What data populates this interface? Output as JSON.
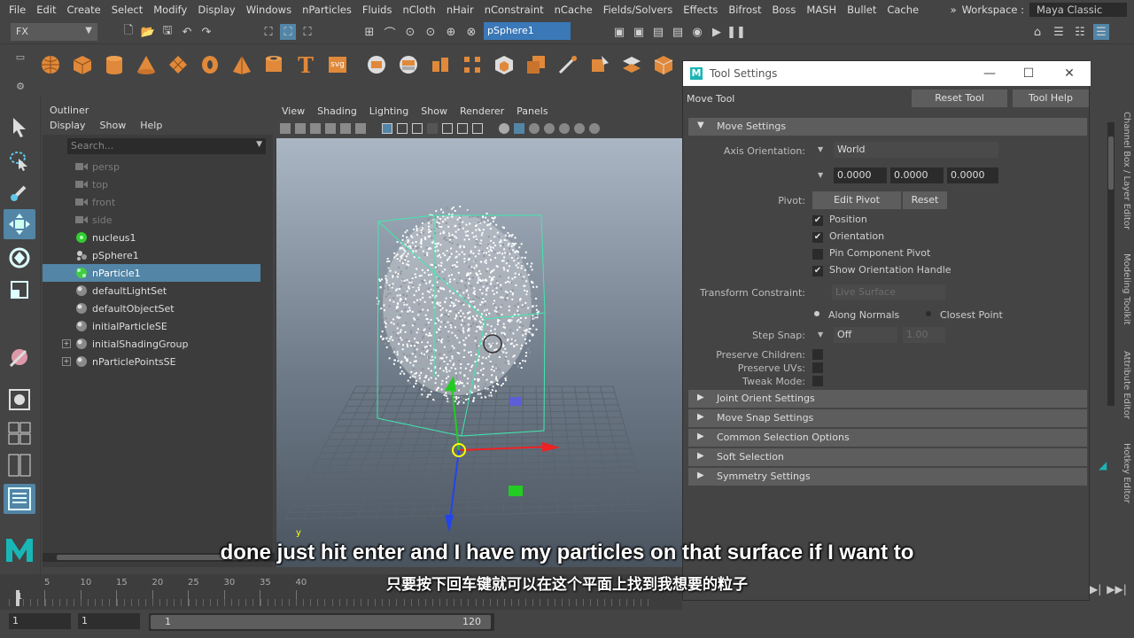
{
  "menubar": {
    "items": [
      "File",
      "Edit",
      "Create",
      "Select",
      "Modify",
      "Display",
      "Windows",
      "nParticles",
      "Fluids",
      "nCloth",
      "nHair",
      "nConstraint",
      "nCache",
      "Fields/Solvers",
      "Effects",
      "Bifrost",
      "Boss",
      "MASH",
      "Bullet",
      "Cache"
    ],
    "workspace_label": "Workspace :",
    "workspace_value": "Maya Classic"
  },
  "statusline": {
    "menuset": "FX",
    "object_name": "pSphere1"
  },
  "outliner": {
    "title": "Outliner",
    "menu": [
      "Display",
      "Show",
      "Help"
    ],
    "search_placeholder": "Search...",
    "items": [
      {
        "label": "persp",
        "icon": "camera-icon",
        "dim": true,
        "selected": false,
        "expand": false
      },
      {
        "label": "top",
        "icon": "camera-icon",
        "dim": true,
        "selected": false,
        "expand": false
      },
      {
        "label": "front",
        "icon": "camera-icon",
        "dim": true,
        "selected": false,
        "expand": false
      },
      {
        "label": "side",
        "icon": "camera-icon",
        "dim": true,
        "selected": false,
        "expand": false
      },
      {
        "label": "nucleus1",
        "icon": "nucleus-icon",
        "dim": false,
        "selected": false,
        "expand": false
      },
      {
        "label": "pSphere1",
        "icon": "mesh-icon",
        "dim": false,
        "selected": false,
        "expand": false
      },
      {
        "label": "nParticle1",
        "icon": "nparticle-icon",
        "dim": false,
        "selected": true,
        "expand": false
      },
      {
        "label": "defaultLightSet",
        "icon": "set-icon",
        "dim": false,
        "selected": false,
        "expand": false
      },
      {
        "label": "defaultObjectSet",
        "icon": "set-icon",
        "dim": false,
        "selected": false,
        "expand": false
      },
      {
        "label": "initialParticleSE",
        "icon": "set-icon",
        "dim": false,
        "selected": false,
        "expand": false
      },
      {
        "label": "initialShadingGroup",
        "icon": "set-icon",
        "dim": false,
        "selected": false,
        "expand": true
      },
      {
        "label": "nParticlePointsSE",
        "icon": "set-icon",
        "dim": false,
        "selected": false,
        "expand": true
      }
    ]
  },
  "viewport": {
    "menu": [
      "View",
      "Shading",
      "Lighting",
      "Show",
      "Renderer",
      "Panels"
    ],
    "axis_label": "y"
  },
  "tool_settings": {
    "window_title": "Tool Settings",
    "tool_name": "Move Tool",
    "reset_tool": "Reset Tool",
    "tool_help": "Tool Help",
    "move_settings": "Move Settings",
    "axis_orientation_label": "Axis Orientation:",
    "axis_orientation_value": "World",
    "vals": [
      "0.0000",
      "0.0000",
      "0.0000"
    ],
    "pivot_label": "Pivot:",
    "edit_pivot": "Edit Pivot",
    "reset": "Reset",
    "checks": [
      {
        "label": "Position",
        "checked": true
      },
      {
        "label": "Orientation",
        "checked": true
      },
      {
        "label": "Pin Component Pivot",
        "checked": false
      },
      {
        "label": "Show Orientation Handle",
        "checked": true
      }
    ],
    "transform_constraint_label": "Transform Constraint:",
    "transform_constraint_value": "Live Surface",
    "along_normals": "Along Normals",
    "closest_point": "Closest Point",
    "step_snap_label": "Step Snap:",
    "step_snap_value": "Off",
    "step_snap_amount": "1.00",
    "preserve_children": "Preserve Children:",
    "preserve_uvs": "Preserve UVs:",
    "tweak_mode": "Tweak Mode:",
    "collapsed_sections": [
      "Joint Orient Settings",
      "Move Snap Settings",
      "Common Selection Options",
      "Soft Selection",
      "Symmetry Settings"
    ]
  },
  "timeline": {
    "ticks": [
      "5",
      "10",
      "15",
      "20",
      "25",
      "30",
      "35",
      "40"
    ],
    "current_frame": "1",
    "range_start": "1",
    "range_inner_start": "1",
    "range_inner_end": "120"
  },
  "right_tabs": [
    "Channel Box / Layer Editor",
    "Modeling Toolkit",
    "Attribute Editor",
    "Hotkey Editor"
  ],
  "subtitles": {
    "en": "done just hit enter and I have my particles on that surface if I want to",
    "zh": "只要按下回车键就可以在这个平面上找到我想要的粒子"
  },
  "colors": {
    "selection": "#5285a6",
    "shelf_orange": "#e0893a",
    "bounding_box": "#3fe9b0"
  }
}
